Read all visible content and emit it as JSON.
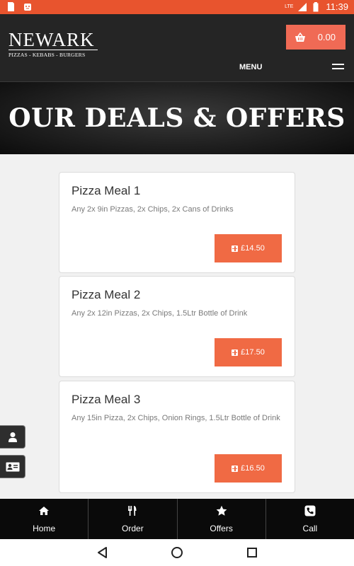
{
  "status_bar": {
    "time": "11:39",
    "network": "LTE",
    "icons": [
      "sim-card-icon",
      "android-debug-icon",
      "signal-icon",
      "battery-icon"
    ]
  },
  "header": {
    "brand_name": "NEWARK",
    "brand_tagline": "PIZZAS - KEBABS - BURGERS",
    "cart_total": "0.00",
    "menu_label": "MENU"
  },
  "banner": {
    "title": "OUR DEALS & OFFERS"
  },
  "deals": [
    {
      "name": "Pizza Meal 1",
      "description": "Any 2x 9in Pizzas, 2x Chips, 2x Cans of Drinks",
      "price": "£14.50"
    },
    {
      "name": "Pizza Meal 2",
      "description": "Any 2x 12in Pizzas, 2x Chips, 1.5Ltr Bottle of Drink",
      "price": "£17.50"
    },
    {
      "name": "Pizza Meal 3",
      "description": "Any 15in Pizza, 2x Chips, Onion Rings, 1.5Ltr Bottle of Drink",
      "price": "£16.50"
    }
  ],
  "side_tabs": [
    "user-icon",
    "contact-card-icon"
  ],
  "bottom_nav": [
    {
      "label": "Home",
      "icon": "home-icon"
    },
    {
      "label": "Order",
      "icon": "cutlery-icon"
    },
    {
      "label": "Offers",
      "icon": "star-icon"
    },
    {
      "label": "Call",
      "icon": "phone-icon"
    }
  ],
  "colors": {
    "status_bar": "#e8542e",
    "header_bg": "#252525",
    "cart_button": "#f06a55",
    "price_button": "#f06a44",
    "bottom_nav_bg": "#0a0a0a"
  }
}
